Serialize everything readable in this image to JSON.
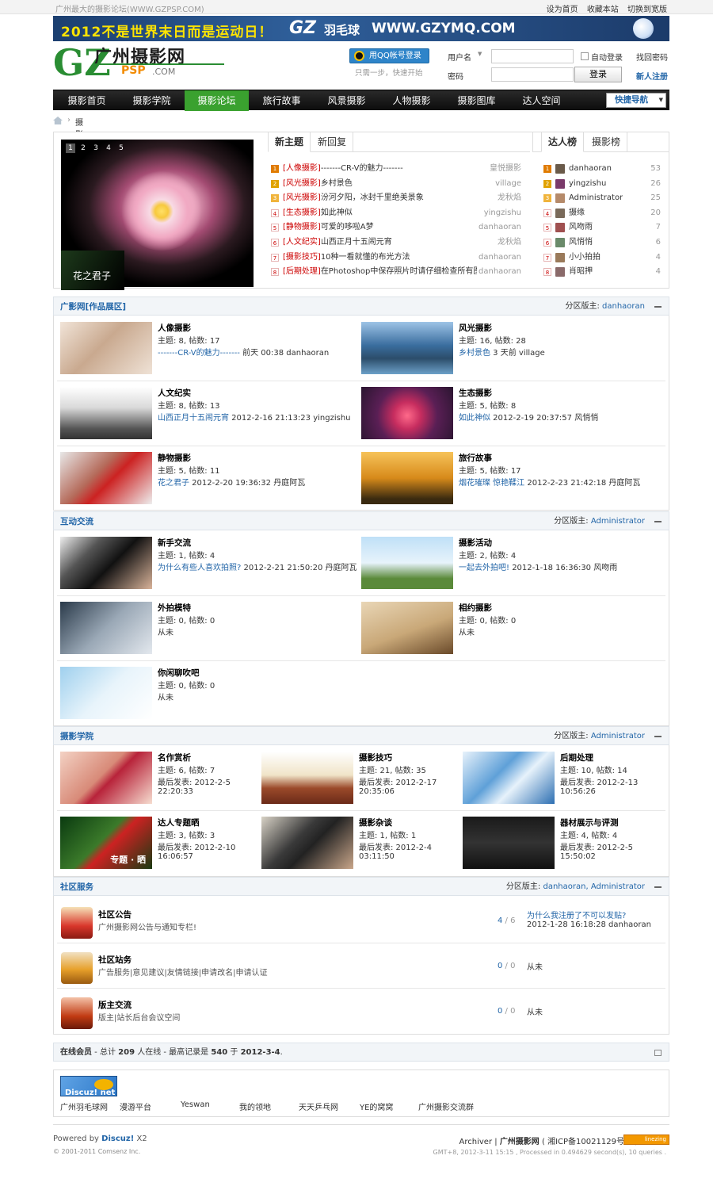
{
  "topbar": {
    "site_slogan": "广州最大的摄影论坛(WWW.GZPSP.COM)",
    "links": [
      "设为首页",
      "收藏本站",
      "切换到宽版"
    ]
  },
  "banner": {
    "text1": "2012不是世界末日而是运动日！",
    "logo_gz": "GZ",
    "logo_word": "羽毛球",
    "url": "WWW.GZYMQ.COM"
  },
  "logo": {
    "letters": "GZ",
    "name": "广州摄影网",
    "psp": "PSP",
    "com": ".COM"
  },
  "qq": {
    "button": "用QQ帐号登录",
    "hint": "只需一步，快速开始"
  },
  "login": {
    "username_label": "用户名",
    "password_label": "密码",
    "remember": "自动登录",
    "forgot": "找回密码",
    "submit": "登录",
    "register": "新人注册"
  },
  "nav": {
    "items": [
      "摄影首页",
      "摄影学院",
      "摄影论坛",
      "旅行故事",
      "风景摄影",
      "人物摄影",
      "摄影图库",
      "达人空间"
    ],
    "active": "摄影论坛",
    "quick": "快捷导航"
  },
  "breadcrumb": {
    "current": "摄影论坛"
  },
  "slideshow": {
    "pages": [
      "1",
      "2",
      "3",
      "4",
      "5"
    ],
    "caption": "花之君子"
  },
  "hot_tabs": [
    "新主题",
    "新回复"
  ],
  "hot_threads": [
    {
      "n": "1",
      "tag": "[人像摄影]",
      "title": "-------CR-V的魅力-------",
      "author": "皇悦摄影"
    },
    {
      "n": "2",
      "tag": "[风光摄影]",
      "title": "乡村景色",
      "author": "village"
    },
    {
      "n": "3",
      "tag": "[风光摄影]",
      "title": "汾河夕阳，冰封千里绝美景象",
      "author": "龙秋焰"
    },
    {
      "n": "4",
      "tag": "[生态摄影]",
      "title": "如此神似",
      "author": "yingzishu"
    },
    {
      "n": "5",
      "tag": "[静物摄影]",
      "title": "可爱的哆啦A梦",
      "author": "danhaoran"
    },
    {
      "n": "6",
      "tag": "[人文纪实]",
      "title": "山西正月十五闹元宵",
      "author": "龙秋焰"
    },
    {
      "n": "7",
      "tag": "[摄影技巧]",
      "title": "10种一看就懂的布光方法",
      "author": "danhaoran"
    },
    {
      "n": "8",
      "tag": "[后期处理]",
      "title": "在Photoshop中保存照片时请仔细检查所有图",
      "author": "danhaoran"
    }
  ],
  "rank_tabs": [
    "达人榜",
    "摄影榜"
  ],
  "ranks": [
    {
      "n": "1",
      "name": "danhaoran",
      "score": "53"
    },
    {
      "n": "2",
      "name": "yingzishu",
      "score": "26"
    },
    {
      "n": "3",
      "name": "Administrator",
      "score": "25"
    },
    {
      "n": "4",
      "name": "摄缘",
      "score": "20"
    },
    {
      "n": "5",
      "name": "风吻雨",
      "score": "7"
    },
    {
      "n": "6",
      "name": "风悄悄",
      "score": "6"
    },
    {
      "n": "7",
      "name": "小小拍拍",
      "score": "4"
    },
    {
      "n": "8",
      "name": "肖昭押",
      "score": "4"
    }
  ],
  "sections": {
    "works": {
      "title": "广影网[作品展区]",
      "mod_label": "分区版主:",
      "mods": "danhaoran"
    },
    "interact": {
      "title": "互动交流",
      "mod_label": "分区版主:",
      "mods": "Administrator"
    },
    "academy": {
      "title": "摄影学院",
      "mod_label": "分区版主:",
      "mods": "Administrator"
    },
    "service": {
      "title": "社区服务",
      "mod_label": "分区版主:",
      "mods": "danhaoran, Administrator"
    }
  },
  "works": [
    {
      "name": "人像摄影",
      "stats": "主题: 8, 帖数: 17",
      "last": "-------CR-V的魅力-------",
      "meta": " 前天 00:38 danhaoran"
    },
    {
      "name": "风光摄影",
      "stats": "主题: 16, 帖数: 28",
      "last": "乡村景色",
      "meta": " 3 天前  village"
    },
    {
      "name": "人文纪实",
      "stats": "主题: 8, 帖数: 13",
      "last": "山西正月十五闹元宵",
      "meta": " 2012-2-16 21:13:23 yingzishu"
    },
    {
      "name": "生态摄影",
      "stats": "主题: 5, 帖数: 8",
      "last": "如此神似",
      "meta": " 2012-2-19 20:37:57 风悄悄"
    },
    {
      "name": "静物摄影",
      "stats": "主题: 5, 帖数: 11",
      "last": "花之君子",
      "meta": " 2012-2-20 19:36:32 丹庭阿瓦"
    },
    {
      "name": "旅行故事",
      "stats": "主题: 5, 帖数: 17",
      "last": "烟花璀璨  惊艳鞣江",
      "meta": " 2012-2-23 21:42:18 丹庭阿瓦"
    }
  ],
  "interact": [
    {
      "name": "新手交流",
      "stats": "主题: 1, 帖数: 4",
      "last": "为什么有些人喜欢拍照?",
      "meta": " 2012-2-21 21:50:20 丹庭阿瓦"
    },
    {
      "name": "摄影活动",
      "stats": "主题: 2, 帖数: 4",
      "last": "一起去外拍吧!",
      "meta": " 2012-1-18 16:36:30 风吻雨"
    },
    {
      "name": "外拍模特",
      "stats": "主题: 0, 帖数: 0",
      "last": "",
      "meta": "从未"
    },
    {
      "name": "相约摄影",
      "stats": "主题: 0, 帖数: 0",
      "last": "",
      "meta": "从未"
    },
    {
      "name": "你闲聊吹吧",
      "stats": "主题: 0, 帖数: 0",
      "last": "",
      "meta": "从未"
    }
  ],
  "academy": [
    {
      "name": "名作赏析",
      "stats": "主题: 6, 帖数: 7",
      "date": "最后发表: 2012-2-5",
      "time": "22:20:33"
    },
    {
      "name": "摄影技巧",
      "stats": "主题: 21, 帖数: 35",
      "date": "最后发表: 2012-2-17",
      "time": "20:35:06"
    },
    {
      "name": "后期处理",
      "stats": "主题: 10, 帖数: 14",
      "date": "最后发表: 2012-2-13",
      "time": "10:56:26"
    },
    {
      "name": "达人专题晒",
      "stats": "主题: 3, 帖数: 3",
      "date": "最后发表: 2012-2-10",
      "time": "16:06:57"
    },
    {
      "name": "摄影杂谈",
      "stats": "主题: 1, 帖数: 1",
      "date": "最后发表: 2012-2-4",
      "time": "03:11:50"
    },
    {
      "name": "器材展示与评测",
      "stats": "主题: 4, 帖数: 4",
      "date": "最后发表: 2012-2-5",
      "time": "15:50:02"
    }
  ],
  "academy_badge": "专题 · 晒",
  "service": [
    {
      "name": "社区公告",
      "desc": "广州摄影网公告与通知专栏!",
      "count": "4",
      "total": "6",
      "last": "为什么我注册了不可以发贴?",
      "meta": "2012-1-28 16:18:28 danhaoran"
    },
    {
      "name": "社区站务",
      "desc": "广告服务|意见建议|友情链接|申请改名|申请认证",
      "count": "0",
      "total": "0",
      "last": "",
      "meta": "从未"
    },
    {
      "name": "版主交流",
      "desc": "版主|站长后台会议空间",
      "count": "0",
      "total": "0",
      "last": "",
      "meta": "从未"
    }
  ],
  "online": {
    "label": "在线会员",
    "sep1": " - 总计 ",
    "total": "209",
    "sep2": " 人在线 - 最高记录是 ",
    "record": "540",
    "sep3": " 于 ",
    "date": "2012-3-4",
    "end": "."
  },
  "friend_links": {
    "logo": "Discuz! net",
    "items": [
      "广州羽毛球网",
      "漫游平台",
      "Yeswan",
      "我的领地",
      "天天乒乓网",
      "YE的窝窝",
      "广州摄影交流群"
    ]
  },
  "footer": {
    "powered": "Powered by",
    "discuz": "Discuz!",
    "ver": " X2",
    "copyright": "© 2001-2011 Comsenz Inc.",
    "archiver": "Archiver",
    "site": "广州摄影网",
    "icp": "( 湘ICP备10021129号-4 )",
    "stats": "GMT+8, 2012-3-11 15:15 , Processed in 0.494629 second(s), 10 queries .",
    "badge": "linezing"
  },
  "colors": {
    "link": "#2366a8",
    "active_nav": "#3aa12f",
    "tag_red": "#cc0000"
  }
}
